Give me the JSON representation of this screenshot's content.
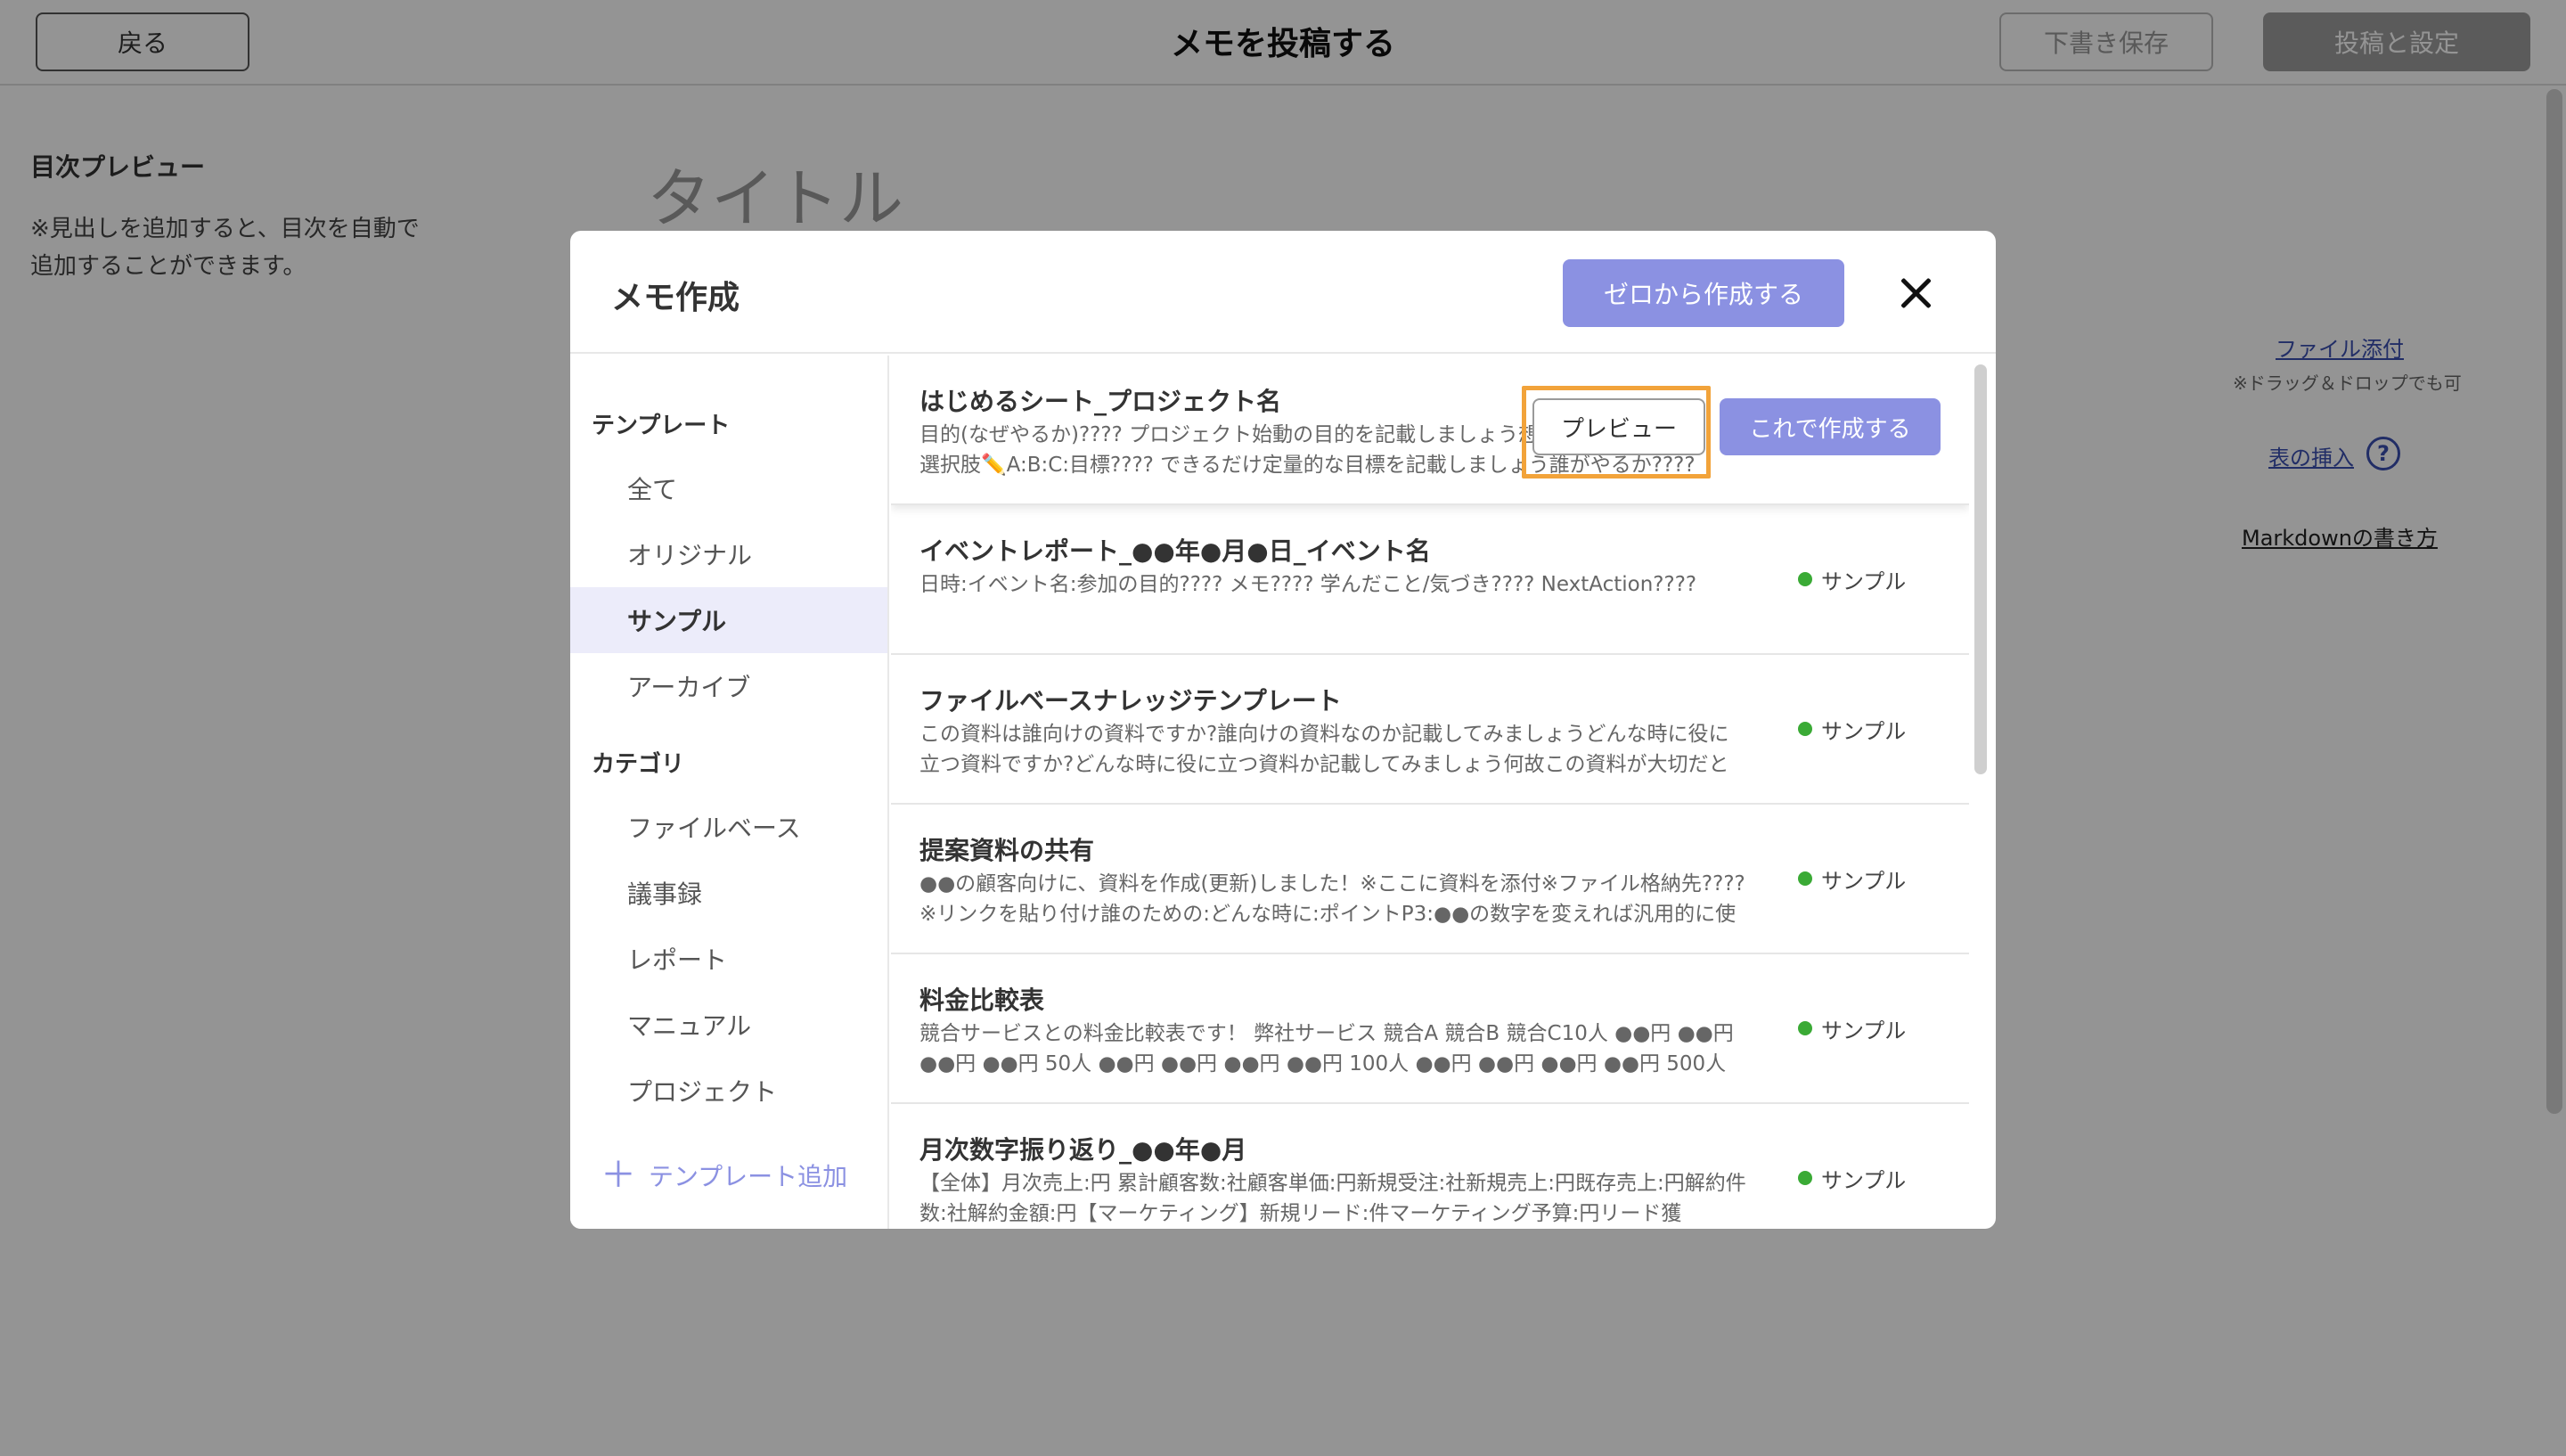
{
  "topbar": {
    "back_label": "戻る",
    "title": "メモを投稿する",
    "draft_label": "下書き保存",
    "publish_label": "投稿と設定"
  },
  "toc": {
    "title": "目次プレビュー",
    "note": "※見出しを追加すると、目次を自動で追加することができます。"
  },
  "editor": {
    "title_placeholder": "タイトル"
  },
  "side_tools": {
    "attach_label": "ファイル添付",
    "attach_note": "※ドラッグ＆ドロップでも可",
    "table_label": "表の挿入",
    "help_glyph": "?",
    "markdown_label": "Markdownの書き方"
  },
  "modal": {
    "title": "メモ作成",
    "create_from_zero_label": "ゼロから作成する",
    "sidebar": {
      "template_heading": "テンプレート",
      "template_items": [
        {
          "label": "全て",
          "active": false
        },
        {
          "label": "オリジナル",
          "active": false
        },
        {
          "label": "サンプル",
          "active": true
        },
        {
          "label": "アーカイブ",
          "active": false
        }
      ],
      "category_heading": "カテゴリ",
      "category_items": [
        {
          "label": "ファイルベース"
        },
        {
          "label": "議事録"
        },
        {
          "label": "レポート"
        },
        {
          "label": "マニュアル"
        },
        {
          "label": "プロジェクト"
        }
      ],
      "add_template_label": "テンプレート追加"
    },
    "templates": [
      {
        "title": "はじめるシート_プロジェクト名",
        "description": "目的(なぜやるか)???? プロジェクト始動の目的を記載しましょう想定される課題???? 選択肢✏️A:B:C:目標???? できるだけ定量的な目標を記載しましょう誰がやるか???? 担当者を",
        "preview_label": "プレビュー",
        "create_label": "これで作成する"
      },
      {
        "title": "イベントレポート_●●年●月●日_イベント名",
        "description": "日時:イベント名:参加の目的???? メモ???? 学んだこと/気づき???? NextAction????",
        "badge": "サンプル"
      },
      {
        "title": "ファイルベースナレッジテンプレート",
        "description": "この資料は誰向けの資料ですか?誰向けの資料なのか記載してみましょうどんな時に役に立つ資料ですか?どんな時に役に立つ資料か記載してみましょう何故この資料が大切だと思い",
        "badge": "サンプル"
      },
      {
        "title": "提案資料の共有",
        "description": "●●の顧客向けに、資料を作成(更新)しました！※ここに資料を添付※ファイル格納先???? ※リンクを貼り付け誰のための:どんな時に:ポイントP3:●●の数字を変えれば汎用的に使",
        "badge": "サンプル"
      },
      {
        "title": "料金比較表",
        "description": "競合サービスとの料金比較表です！ 弊社サービス 競合A 競合B 競合C10人 ●●円 ●●円 ●●円 ●●円 50人 ●●円 ●●円 ●●円 ●●円 100人 ●●円 ●●円 ●●円 ●●円 500人",
        "badge": "サンプル"
      },
      {
        "title": "月次数字振り返り_●●年●月",
        "description": "【全体】月次売上:円 累計顧客数:社顧客単価:円新規受注:社新規売上:円既存売上:円解約件数:社解約金額:円【マーケティング】新規リード:件マーケティング予算:円リード獲",
        "badge": "サンプル"
      }
    ]
  }
}
